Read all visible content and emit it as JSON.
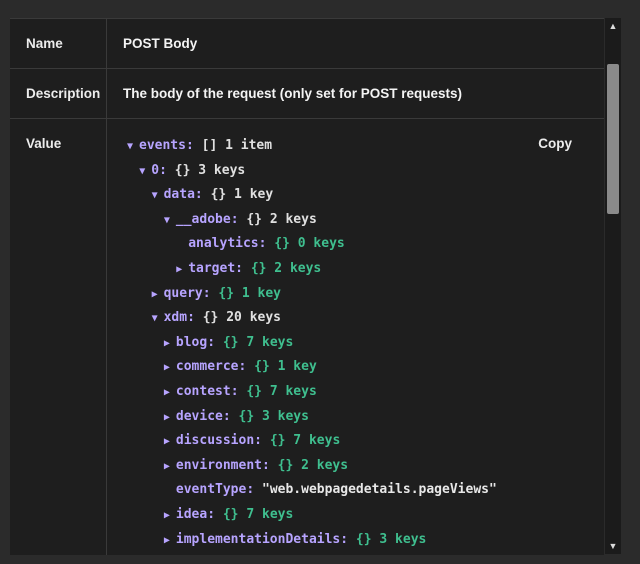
{
  "fields": {
    "name_label": "Name",
    "name_value": "POST Body",
    "description_label": "Description",
    "description_value": "The body of the request (only set for POST requests)",
    "value_label": "Value",
    "copy_label": "Copy"
  },
  "tree": [
    {
      "depth": 0,
      "arrow": "▼",
      "key": "events",
      "brace": "[]",
      "count": "1 item",
      "style": "plain"
    },
    {
      "depth": 1,
      "arrow": "▼",
      "key": "0",
      "brace": "{}",
      "count": "3 keys",
      "style": "plain"
    },
    {
      "depth": 2,
      "arrow": "▼",
      "key": "data",
      "brace": "{}",
      "count": "1 key",
      "style": "plain"
    },
    {
      "depth": 3,
      "arrow": "▼",
      "key": "__adobe",
      "brace": "{}",
      "count": "2 keys",
      "style": "plain"
    },
    {
      "depth": 4,
      "arrow": "",
      "key": "analytics",
      "brace": "{}",
      "count": "0 keys",
      "style": "green"
    },
    {
      "depth": 4,
      "arrow": "▶",
      "key": "target",
      "brace": "{}",
      "count": "2 keys",
      "style": "green"
    },
    {
      "depth": 2,
      "arrow": "▶",
      "key": "query",
      "brace": "{}",
      "count": "1 key",
      "style": "green"
    },
    {
      "depth": 2,
      "arrow": "▼",
      "key": "xdm",
      "brace": "{}",
      "count": "20 keys",
      "style": "plain"
    },
    {
      "depth": 3,
      "arrow": "▶",
      "key": "blog",
      "brace": "{}",
      "count": "7 keys",
      "style": "green"
    },
    {
      "depth": 3,
      "arrow": "▶",
      "key": "commerce",
      "brace": "{}",
      "count": "1 key",
      "style": "green"
    },
    {
      "depth": 3,
      "arrow": "▶",
      "key": "contest",
      "brace": "{}",
      "count": "7 keys",
      "style": "green"
    },
    {
      "depth": 3,
      "arrow": "▶",
      "key": "device",
      "brace": "{}",
      "count": "3 keys",
      "style": "green"
    },
    {
      "depth": 3,
      "arrow": "▶",
      "key": "discussion",
      "brace": "{}",
      "count": "7 keys",
      "style": "green"
    },
    {
      "depth": 3,
      "arrow": "▶",
      "key": "environment",
      "brace": "{}",
      "count": "2 keys",
      "style": "green"
    },
    {
      "depth": 3,
      "arrow": "",
      "key": "eventType",
      "string": "\"web.webpagedetails.pageViews\"",
      "style": "string"
    },
    {
      "depth": 3,
      "arrow": "▶",
      "key": "idea",
      "brace": "{}",
      "count": "7 keys",
      "style": "green"
    },
    {
      "depth": 3,
      "arrow": "▶",
      "key": "implementationDetails",
      "brace": "{}",
      "count": "3 keys",
      "style": "green"
    }
  ],
  "scrollbar": {
    "up_icon": "triangle-up",
    "down_icon": "triangle-down"
  }
}
